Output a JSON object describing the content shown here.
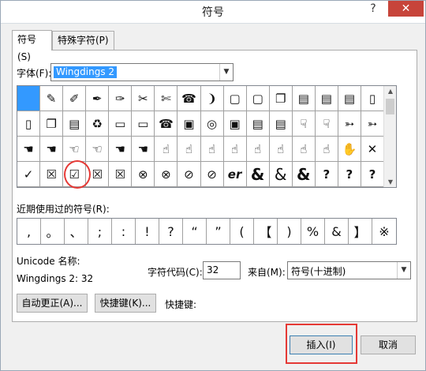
{
  "window": {
    "title": "符号",
    "help": "?",
    "close": "✕"
  },
  "tabs": [
    {
      "label": "符号(S)"
    },
    {
      "label": "特殊字符(P)"
    }
  ],
  "font": {
    "label": "字体(F):",
    "value": "Wingdings 2"
  },
  "symbols": [
    "",
    "✎",
    "✐",
    "✒",
    "✑",
    "✂",
    "✄",
    "☎",
    "❩",
    "▢",
    "▢",
    "❐",
    "▤",
    "▤",
    "▤",
    "▯",
    "▯",
    "❐",
    "▤",
    "♻",
    "▭",
    "▭",
    "☎",
    "▣",
    "◎",
    "▣",
    "▤",
    "▤",
    "☟",
    "☟",
    "➳",
    "➳",
    "☚",
    "☚",
    "☜",
    "☜",
    "☚",
    "☚",
    "☝",
    "☝",
    "☝",
    "☝",
    "☝",
    "☝",
    "☝",
    "☝",
    "✋",
    "✕",
    "✓",
    "☒",
    "☑",
    "☒",
    "☒",
    "⊗",
    "⊗",
    "⊘",
    "⊘",
    "er",
    "&",
    "&",
    "&",
    "?",
    "?",
    "?"
  ],
  "recent": {
    "label": "近期使用过的符号(R):",
    "items": [
      ",",
      "。",
      "、",
      ";",
      ":",
      "!",
      "?",
      "“",
      "”",
      "(",
      "【",
      ")",
      "%",
      "&",
      "】",
      "※"
    ]
  },
  "unicode_name_label": "Unicode 名称:",
  "unicode_name_value": "Wingdings 2: 32",
  "char_code": {
    "label": "字符代码(C):",
    "value": "32"
  },
  "from": {
    "label": "来自(M):",
    "value": "符号(十进制)"
  },
  "buttons": {
    "autocorrect": "自动更正(A)...",
    "shortcut": "快捷键(K)...",
    "shortcut_label": "快捷键:",
    "insert": "插入(I)",
    "cancel": "取消"
  }
}
